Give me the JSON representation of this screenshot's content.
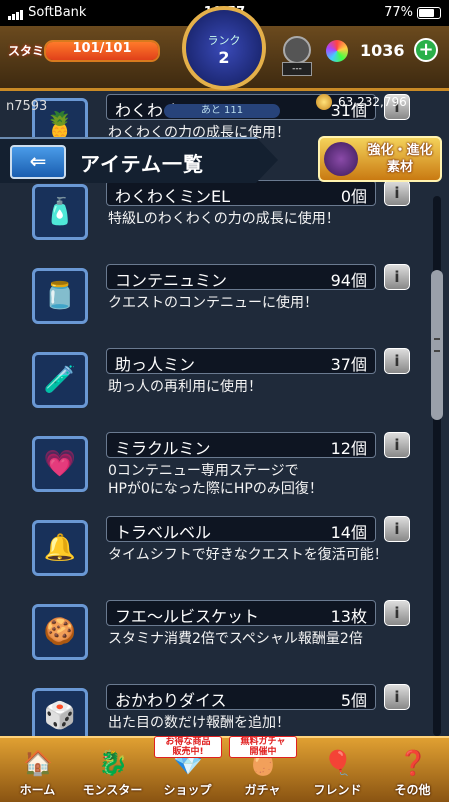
{
  "status_bar": {
    "carrier": "SoftBank",
    "time": "10:57",
    "battery": "77%"
  },
  "hud": {
    "stamina_label": "スタミナ",
    "stamina_value": "101/101",
    "stamina_fraction": 1.0,
    "rank_label": "ランク",
    "rank_value": "2",
    "gem_sub": "---",
    "orb_count": "1036",
    "plus": "+"
  },
  "subheader": {
    "username": "n7593",
    "next_rank": "あと 111",
    "coins": "63,232,796"
  },
  "title": {
    "back": "⇐",
    "text": "アイテム一覧",
    "evolve_label_1": "強化",
    "evolve_label_2": "進化",
    "evolve_label_3": "素材"
  },
  "items": [
    {
      "name": "わくわく",
      "count": "31個",
      "desc": "わくわくの力の成長に使用！",
      "icon": "🍍"
    },
    {
      "name": "わくわくミンEL",
      "count": "0個",
      "desc": "特級Lのわくわくの力の成長に使用！",
      "icon": "🧴"
    },
    {
      "name": "コンテニュミン",
      "count": "94個",
      "desc": "クエストのコンテニューに使用！",
      "icon": "🫙"
    },
    {
      "name": "助っ人ミン",
      "count": "37個",
      "desc": "助っ人の再利用に使用！",
      "icon": "🧪"
    },
    {
      "name": "ミラクルミン",
      "count": "12個",
      "desc": "0コンテニュー専用ステージで\nHPが0になった際にHPのみ回復！",
      "icon": "💗"
    },
    {
      "name": "トラベルベル",
      "count": "14個",
      "desc": "タイムシフトで好きなクエストを復活可能！",
      "icon": "🔔"
    },
    {
      "name": "フエ～ルビスケット",
      "count": "13枚",
      "desc": "スタミナ消費2倍でスペシャル報酬量2倍",
      "icon": "🍪"
    },
    {
      "name": "おかわりダイス",
      "count": "5個",
      "desc": "出た目の数だけ報酬を追加！",
      "icon": "🎲"
    }
  ],
  "info_label": "i",
  "nav": [
    {
      "label": "ホーム",
      "icon": "🏠",
      "badge": ""
    },
    {
      "label": "モンスター",
      "icon": "🐉",
      "badge": ""
    },
    {
      "label": "ショップ",
      "icon": "💎",
      "badge": "お得な商品\n販売中!"
    },
    {
      "label": "ガチャ",
      "icon": "🥚",
      "badge": "無料ガチャ\n開催中"
    },
    {
      "label": "フレンド",
      "icon": "🎈",
      "badge": ""
    },
    {
      "label": "その他",
      "icon": "❓",
      "badge": ""
    }
  ]
}
